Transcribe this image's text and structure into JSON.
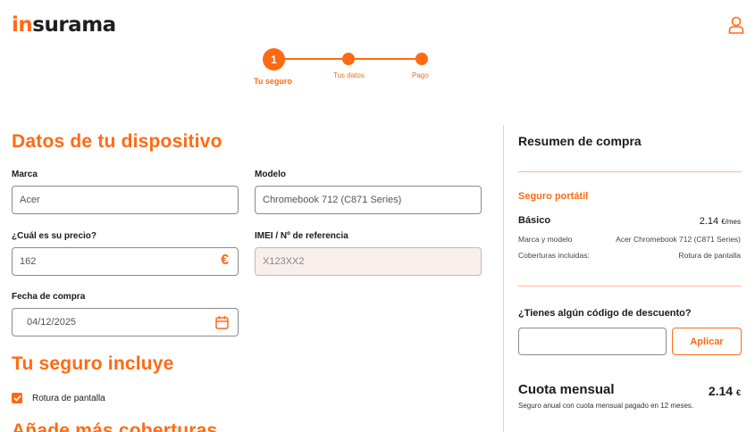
{
  "brand": {
    "logo_prefix": "in",
    "logo_suffix": "surama",
    "accent": "#ff6a13"
  },
  "stepper": {
    "steps": [
      {
        "number": "1",
        "label": "Tu seguro",
        "active": true
      },
      {
        "label": "Tus datos",
        "active": false
      },
      {
        "label": "Pago",
        "active": false
      }
    ]
  },
  "device": {
    "title": "Datos de tu dispositivo",
    "brand_label": "Marca",
    "brand_value": "Acer",
    "model_label": "Modelo",
    "model_value": "Chromebook 712 (C871 Series)",
    "price_label": "¿Cuál es su precio?",
    "price_value": "162",
    "price_suffix": "€",
    "imei_label": "IMEI / Nº de referencia",
    "imei_placeholder": "X123XX2",
    "date_label": "Fecha de compra",
    "date_value": "04/12/2025"
  },
  "includes": {
    "title": "Tu seguro incluye",
    "items": [
      {
        "label": "Rotura de pantalla",
        "checked": true
      }
    ]
  },
  "more": {
    "title": "Añade más coberturas"
  },
  "summary": {
    "title": "Resumen de compra",
    "section": "Seguro portátil",
    "plan": "Básico",
    "plan_price": "2.14",
    "plan_unit": "€/mes",
    "brand_model_label": "Marca y modelo",
    "brand_model_value": "Acer Chromebook 712 (C871 Series)",
    "coverage_label": "Coberturas incluidas:",
    "coverage_value": "Rotura de pantalla",
    "discount_question": "¿Tienes algún código de descuento?",
    "discount_placeholder": "",
    "apply_label": "Aplicar",
    "monthly_label": "Cuota mensual",
    "monthly_price": "2.14",
    "monthly_currency": "€",
    "monthly_note": "Seguro anual con cuota mensual pagado en 12 meses."
  }
}
